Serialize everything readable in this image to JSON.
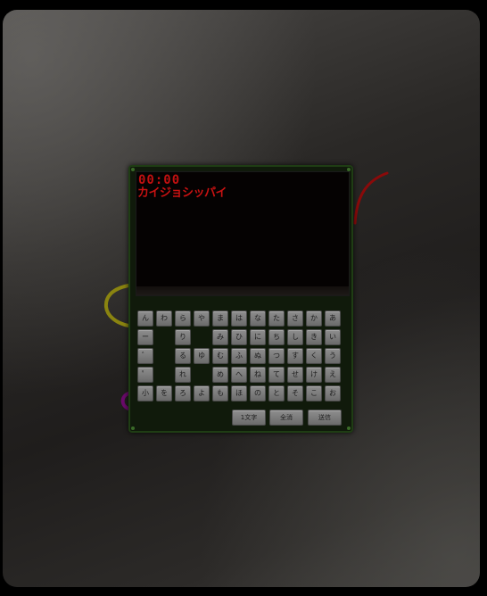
{
  "screen": {
    "timer": "00:00",
    "status": "カイジョシッパイ"
  },
  "keyboard": {
    "rows": [
      [
        "ん",
        "わ",
        "ら",
        "や",
        "ま",
        "は",
        "な",
        "た",
        "さ",
        "か",
        "あ"
      ],
      [
        "ー",
        "",
        "り",
        "",
        "み",
        "ひ",
        "に",
        "ち",
        "し",
        "き",
        "い"
      ],
      [
        "゛",
        "",
        "る",
        "ゆ",
        "む",
        "ふ",
        "ぬ",
        "つ",
        "す",
        "く",
        "う"
      ],
      [
        "゜",
        "",
        "れ",
        "",
        "め",
        "へ",
        "ね",
        "て",
        "せ",
        "け",
        "え"
      ],
      [
        "小",
        "を",
        "ろ",
        "よ",
        "も",
        "ほ",
        "の",
        "と",
        "そ",
        "こ",
        "お"
      ]
    ],
    "actions": {
      "backspace": "1文字",
      "clear": "全消",
      "submit": "送信"
    }
  },
  "colors": {
    "timer": "#c01010",
    "status": "#c81212",
    "device_border": "#1f3d14",
    "deco_red": "#8a0a0a",
    "deco_yellow": "#8a8410",
    "deco_purple": "#6a0a6a"
  }
}
